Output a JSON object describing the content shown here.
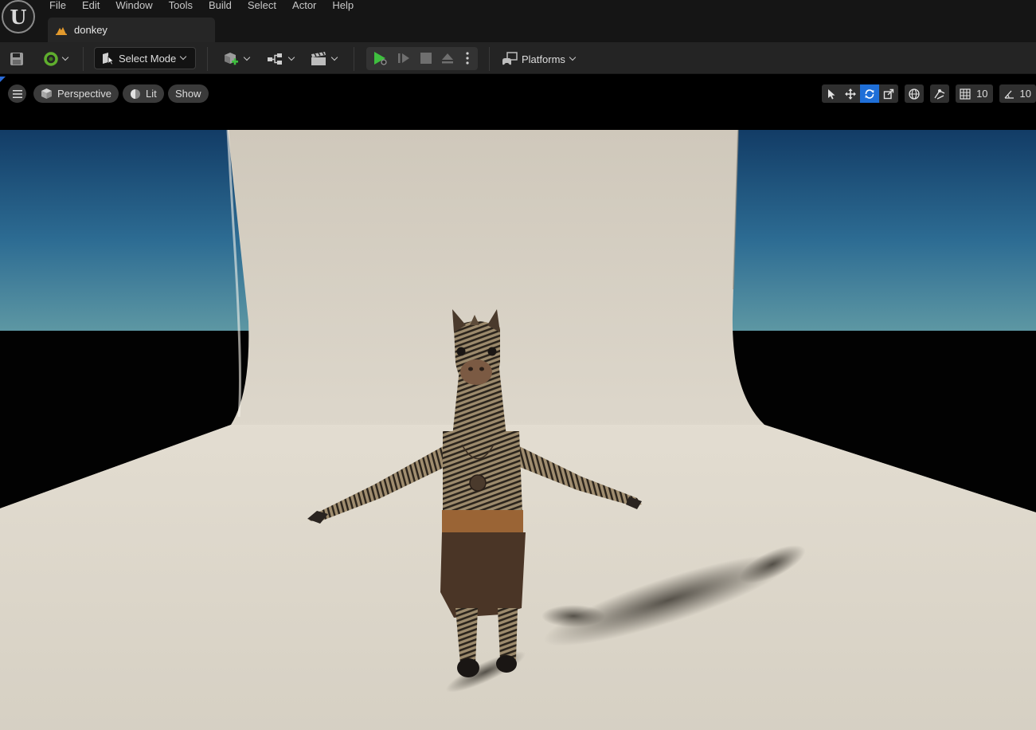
{
  "app": {
    "logo": "U",
    "menu": [
      "File",
      "Edit",
      "Window",
      "Tools",
      "Build",
      "Select",
      "Actor",
      "Help"
    ],
    "tab": {
      "label": "donkey",
      "icon": "level-icon"
    }
  },
  "toolbar": {
    "save_icon": "save-icon",
    "source_control_icon": "source-control-icon",
    "select_mode_label": "Select Mode",
    "add_icon": "add-actor-icon",
    "blueprint_icon": "blueprint-icon",
    "cinematics_icon": "cinematics-icon",
    "play_icons": [
      "play-icon",
      "step-icon",
      "stop-icon",
      "eject-icon",
      "more-icon"
    ],
    "platforms_label": "Platforms",
    "accent": "#3fbf3f"
  },
  "viewport": {
    "perspective_label": "Perspective",
    "lit_label": "Lit",
    "show_label": "Show",
    "grid_snap_value": "10",
    "rotation_snap_value": "10",
    "active_tool_color": "#1f6fd8"
  }
}
